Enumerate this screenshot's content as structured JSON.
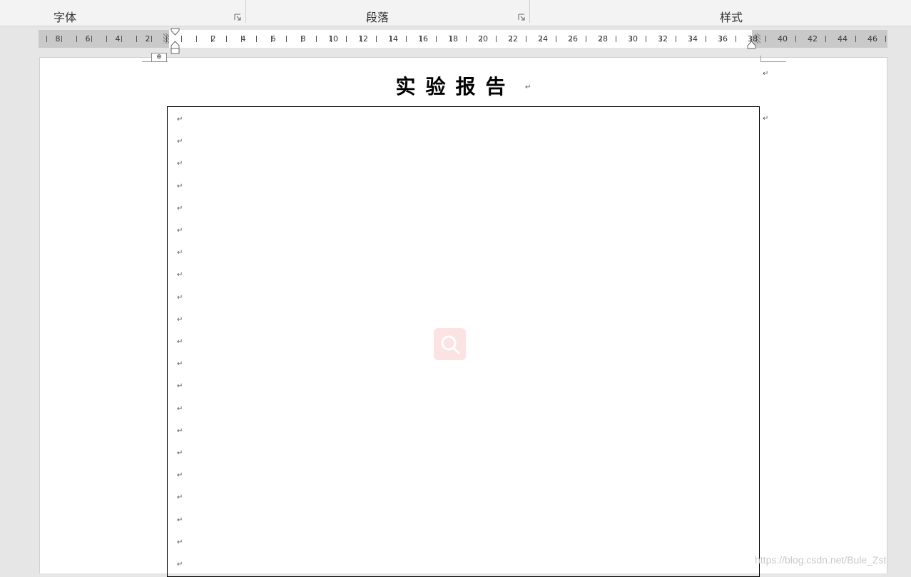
{
  "ribbon": {
    "groups": [
      {
        "label": "字体"
      },
      {
        "label": "段落"
      },
      {
        "label": "样式"
      }
    ]
  },
  "ruler": {
    "left_numbers": [
      "8",
      "6",
      "4",
      "2"
    ],
    "right_numbers": [
      "2",
      "4",
      "6",
      "8",
      "10",
      "12",
      "14",
      "16",
      "18",
      "20",
      "22",
      "24",
      "26",
      "28",
      "30",
      "32",
      "34",
      "36",
      "38",
      "40",
      "42",
      "44",
      "46"
    ]
  },
  "document": {
    "title": "实验报告",
    "paragraph_mark": "↵",
    "table_mover_glyph": "⊕"
  },
  "watermark": {
    "url": "https://blog.csdn.net/Bule_Zst"
  },
  "colors": {
    "ribbon_bg": "#f3f3f3",
    "canvas_bg": "#e6e6e6",
    "ruler_margin": "#c9c9c9",
    "watermark_pink": "#fbe3e3"
  },
  "icons": [
    "dialog-launcher-icon",
    "search-icon",
    "table-move-handle-icon",
    "first-line-indent-icon",
    "hanging-indent-icon",
    "right-indent-icon"
  ]
}
